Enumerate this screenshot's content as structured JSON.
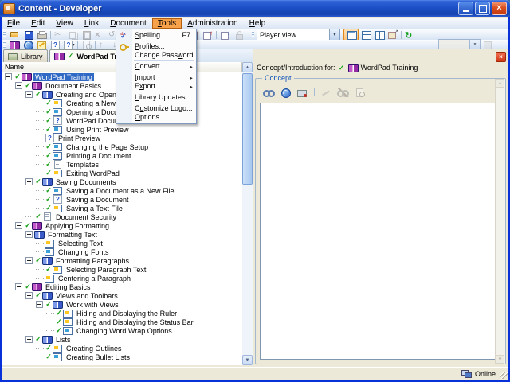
{
  "window": {
    "title": "Content - Developer"
  },
  "colors": {
    "selection": "#316AC5",
    "menu_highlight": "#F7A24A",
    "check_green": "#17A017",
    "titlebar_blue": "#1D50C6"
  },
  "menubar": {
    "items": [
      {
        "label": "File",
        "mn": 0
      },
      {
        "label": "Edit",
        "mn": 0
      },
      {
        "label": "View",
        "mn": 0
      },
      {
        "label": "Link",
        "mn": 0
      },
      {
        "label": "Document",
        "mn": 0
      },
      {
        "label": "Tools",
        "mn": 0,
        "active": true
      },
      {
        "label": "Administration",
        "mn": 0
      },
      {
        "label": "Help",
        "mn": 0
      }
    ]
  },
  "tools_menu": {
    "items": [
      {
        "label": "Spelling...",
        "mn": 0,
        "shortcut": "F7",
        "icon": "spelling",
        "name": "menu-spelling"
      },
      {
        "sep": true
      },
      {
        "label": "Profiles...",
        "mn": 0,
        "icon": "profiles",
        "name": "menu-profiles"
      },
      {
        "label": "Change Password...",
        "mn": 11,
        "name": "menu-change-password"
      },
      {
        "sep": true
      },
      {
        "label": "Convert",
        "mn": 0,
        "submenu": true,
        "name": "menu-convert"
      },
      {
        "sep": true
      },
      {
        "label": "Import",
        "mn": 0,
        "submenu": true,
        "name": "menu-import"
      },
      {
        "label": "Export",
        "mn": 1,
        "submenu": true,
        "name": "menu-export"
      },
      {
        "sep": true
      },
      {
        "label": "Library Updates...",
        "mn": 0,
        "name": "menu-library-updates"
      },
      {
        "sep": true
      },
      {
        "label": "Customize Logo...",
        "mn": 1,
        "name": "menu-customize-logo"
      },
      {
        "label": "Options...",
        "mn": 0,
        "name": "menu-options"
      }
    ]
  },
  "toolbars": {
    "row1": [
      {
        "name": "open-button",
        "icon": "open"
      },
      {
        "name": "save-button",
        "icon": "save"
      },
      {
        "name": "print-button",
        "icon": "print"
      },
      {
        "sep": true
      },
      {
        "name": "cut-button",
        "icon": "cut",
        "disabled": true
      },
      {
        "name": "copy-button",
        "icon": "copy",
        "disabled": true
      },
      {
        "name": "paste-button",
        "icon": "paste",
        "disabled": true
      },
      {
        "name": "delete-button",
        "icon": "delete",
        "disabled": true
      },
      {
        "name": "undo-button",
        "icon": "undo",
        "disabled": true
      }
    ],
    "row1b": [
      {
        "name": "help-button",
        "icon": "help"
      },
      {
        "sep": true
      },
      {
        "name": "check-in-button",
        "icon": "export"
      },
      {
        "name": "check-out-button",
        "icon": "publish"
      },
      {
        "sep": true
      },
      {
        "name": "import-content-button",
        "icon": "import"
      },
      {
        "name": "lock-button",
        "icon": "lock",
        "disabled": true
      }
    ],
    "view_combo": {
      "value": "Player view"
    },
    "layout": [
      {
        "name": "single-pane-view-button",
        "icon": "pane1",
        "active": true
      },
      {
        "name": "split-horizontal-view-button",
        "icon": "pane2"
      },
      {
        "name": "split-vertical-view-button",
        "icon": "pane3"
      },
      {
        "name": "float-view-button",
        "icon": "pane4"
      }
    ],
    "refresh": [
      {
        "name": "refresh-button",
        "icon": "refresh"
      }
    ],
    "row2": [
      {
        "name": "new-lesson-button",
        "icon": "bookp"
      },
      {
        "name": "player-preview-button",
        "icon": "globe"
      },
      {
        "name": "edit-properties-button",
        "icon": "pencilbadge"
      },
      {
        "name": "question-button",
        "icon": "qbox"
      },
      {
        "name": "question-menu-button",
        "icon": "qbox",
        "caret": true
      },
      {
        "sep": true
      },
      {
        "name": "preview-button",
        "icon": "docmag",
        "disabled": true
      },
      {
        "sep": true
      },
      {
        "name": "move-up-button",
        "icon": "up",
        "disabled": true
      },
      {
        "name": "move-down-button",
        "icon": "down",
        "disabled": true
      }
    ],
    "row2_extra": [
      {
        "name": "go-button",
        "icon": "go",
        "disabled": true
      }
    ]
  },
  "tabs": {
    "items": [
      {
        "label": "Library",
        "icon": "library",
        "name": "tab-library"
      },
      {
        "label": "WordPad Training",
        "icon": "bookp",
        "check": true,
        "active": true,
        "closable": true,
        "name": "tab-wordpad-training"
      }
    ]
  },
  "tree": {
    "header": "Name",
    "items": [
      {
        "depth": 0,
        "label": "WordPad Training",
        "icon": "bookp",
        "check": true,
        "expand": true,
        "selected": true
      },
      {
        "depth": 1,
        "label": "Document Basics",
        "icon": "bookp",
        "check": true,
        "expand": true
      },
      {
        "depth": 2,
        "label": "Creating and Opening Documents",
        "icon": "bookb",
        "check": true,
        "expand": true
      },
      {
        "depth": 3,
        "label": "Creating a New Document",
        "icon": "simy",
        "check": true
      },
      {
        "depth": 3,
        "label": "Opening a Document",
        "icon": "simb",
        "check": true
      },
      {
        "depth": 3,
        "label": "WordPad Documents",
        "icon": "q",
        "check": true
      },
      {
        "depth": 3,
        "label": "Using Print Preview",
        "icon": "simb",
        "check": true
      },
      {
        "depth": 3,
        "label": "Print Preview",
        "icon": "q"
      },
      {
        "depth": 3,
        "label": "Changing the Page Setup",
        "icon": "simb",
        "check": true
      },
      {
        "depth": 3,
        "label": "Printing a Document",
        "icon": "simb",
        "check": true
      },
      {
        "depth": 3,
        "label": "Templates",
        "icon": "doc",
        "check": true
      },
      {
        "depth": 3,
        "label": "Exiting WordPad",
        "icon": "simy",
        "check": true
      },
      {
        "depth": 2,
        "label": "Saving Documents",
        "icon": "bookb",
        "check": true,
        "expand": true
      },
      {
        "depth": 3,
        "label": "Saving a Document as a New File",
        "icon": "simb",
        "check": true
      },
      {
        "depth": 3,
        "label": "Saving a Document",
        "icon": "q",
        "check": true
      },
      {
        "depth": 3,
        "label": "Saving a Text File",
        "icon": "simy",
        "check": true
      },
      {
        "depth": 2,
        "label": "Document Security",
        "icon": "doc",
        "check": true
      },
      {
        "depth": 1,
        "label": "Applying Formatting",
        "icon": "bookp",
        "check": true,
        "expand": true
      },
      {
        "depth": 2,
        "label": "Formatting Text",
        "icon": "bookb",
        "expand": true
      },
      {
        "depth": 3,
        "label": "Selecting Text",
        "icon": "simy"
      },
      {
        "depth": 3,
        "label": "Changing Fonts",
        "icon": "simb"
      },
      {
        "depth": 2,
        "label": "Formatting Paragraphs",
        "icon": "bookb",
        "check": true,
        "expand": true
      },
      {
        "depth": 3,
        "label": "Selecting Paragraph Text",
        "icon": "simy",
        "check": true
      },
      {
        "depth": 3,
        "label": "Centering a Paragraph",
        "icon": "simy"
      },
      {
        "depth": 1,
        "label": "Editing Basics",
        "icon": "bookp",
        "check": true,
        "expand": true
      },
      {
        "depth": 2,
        "label": "Views and Toolbars",
        "icon": "bookb",
        "check": true,
        "expand": true
      },
      {
        "depth": 3,
        "label": "Work with Views",
        "icon": "bookb",
        "check": true,
        "expand": true
      },
      {
        "depth": 4,
        "label": "Hiding and Displaying the Ruler",
        "icon": "simy",
        "check": true
      },
      {
        "depth": 4,
        "label": "Hiding and Displaying the Status Bar",
        "icon": "simy",
        "check": true
      },
      {
        "depth": 4,
        "label": "Changing Word Wrap Options",
        "icon": "simb",
        "check": true
      },
      {
        "depth": 2,
        "label": "Lists",
        "icon": "bookb",
        "check": true,
        "expand": true
      },
      {
        "depth": 3,
        "label": "Creating Outlines",
        "icon": "simy",
        "check": true
      },
      {
        "depth": 3,
        "label": "Creating Bullet Lists",
        "icon": "simb",
        "check": true
      }
    ]
  },
  "right_panel": {
    "header_label": "Concept/Introduction for:",
    "header_item": "WordPad Training",
    "group_label": "Concept",
    "toolbar": [
      {
        "name": "insert-link-button",
        "icon": "chain"
      },
      {
        "name": "insert-web-link-button",
        "icon": "globe"
      },
      {
        "name": "insert-file-link-button",
        "icon": "filelink"
      },
      {
        "sep": true
      },
      {
        "name": "edit-button",
        "icon": "pencil",
        "disabled": true
      },
      {
        "name": "remove-link-button",
        "icon": "unlink",
        "disabled": true
      },
      {
        "name": "preview-link-button",
        "icon": "docmag",
        "disabled": true
      }
    ],
    "editor_value": ""
  },
  "statusbar": {
    "status": "Online"
  }
}
